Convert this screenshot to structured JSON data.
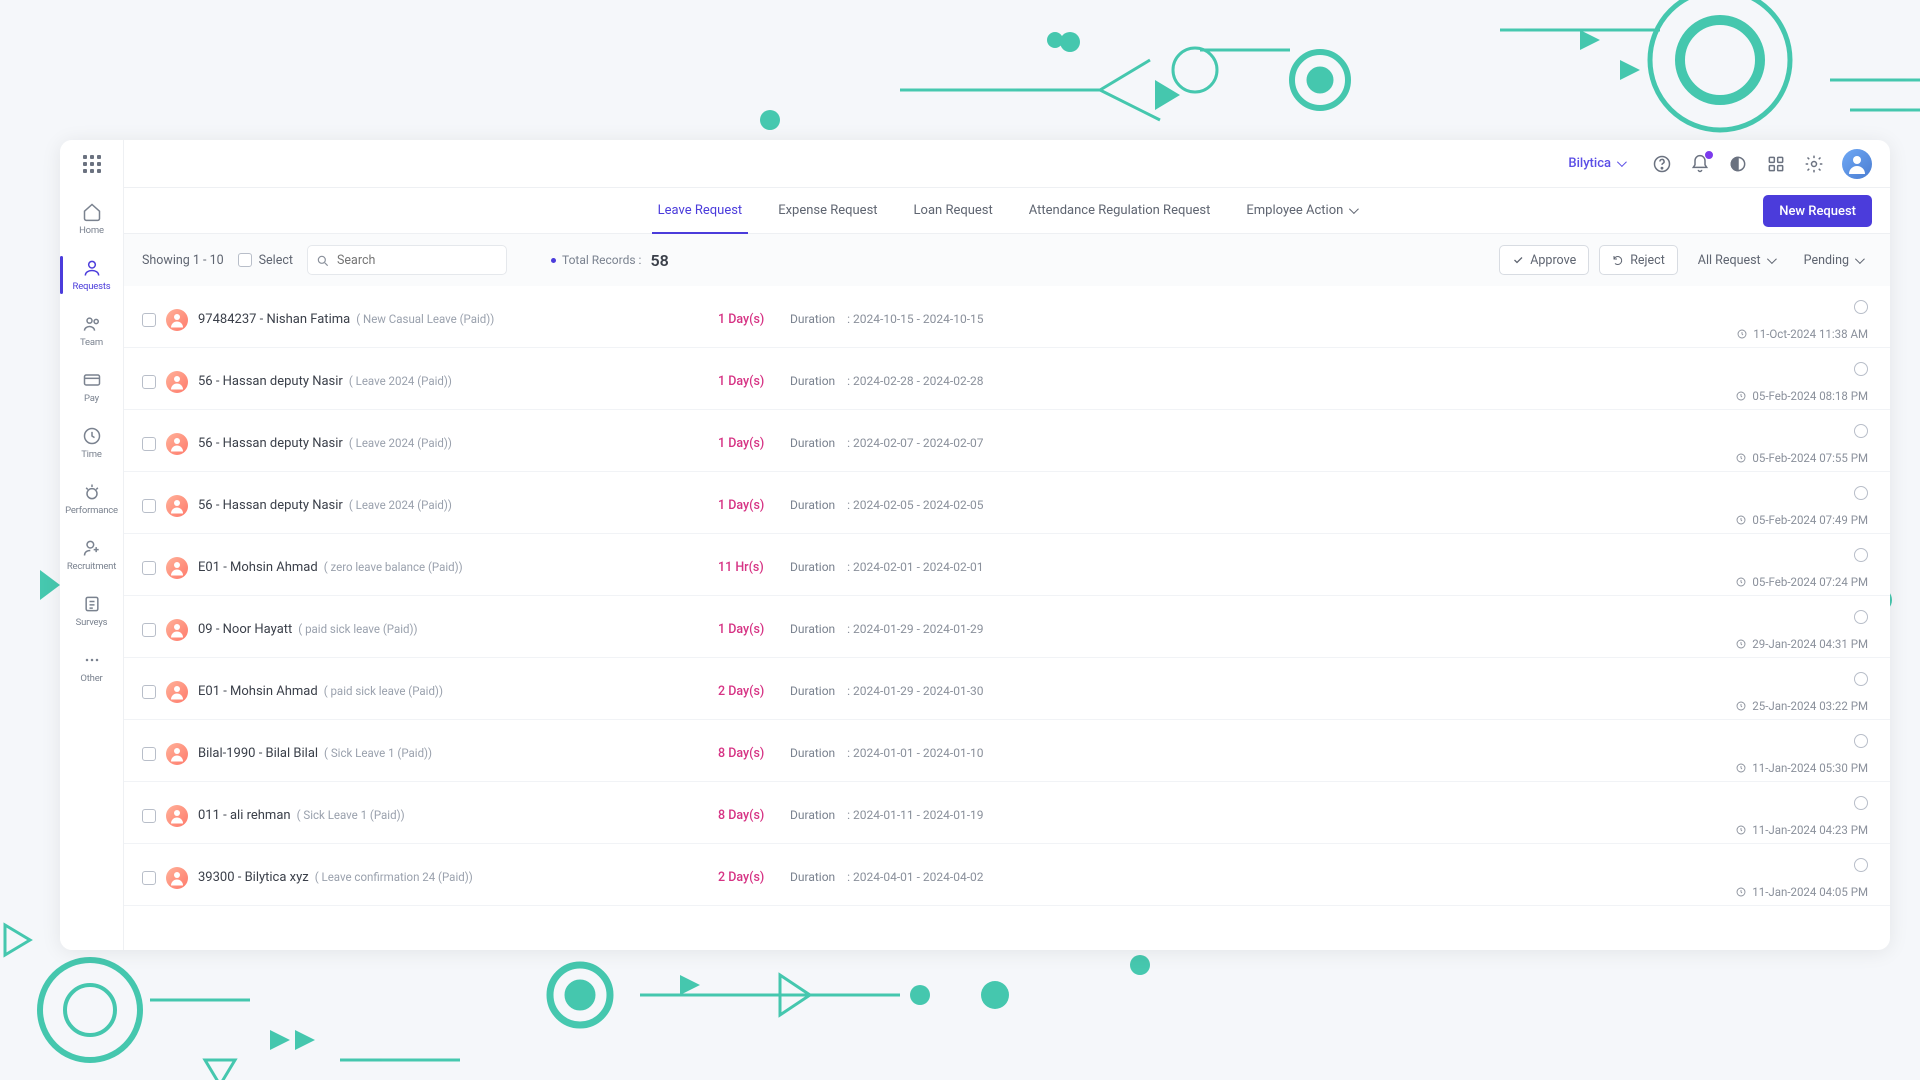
{
  "org": {
    "name": "Bilytica"
  },
  "sidebar": {
    "items": [
      {
        "label": "Home"
      },
      {
        "label": "Requests"
      },
      {
        "label": "Team"
      },
      {
        "label": "Pay"
      },
      {
        "label": "Time"
      },
      {
        "label": "Performance"
      },
      {
        "label": "Recruitment"
      },
      {
        "label": "Surveys"
      },
      {
        "label": "Other"
      }
    ]
  },
  "tabs": {
    "items": [
      {
        "label": "Leave Request"
      },
      {
        "label": "Expense Request"
      },
      {
        "label": "Loan Request"
      },
      {
        "label": "Attendance Regulation Request"
      },
      {
        "label": "Employee Action"
      }
    ],
    "new_button": "New Request"
  },
  "filters": {
    "showing": "Showing 1 - 10",
    "select_label": "Select",
    "search_placeholder": "Search",
    "total_label": "Total Records :",
    "total_value": "58",
    "approve": "Approve",
    "reject": "Reject",
    "all_request": "All Request",
    "pending": "Pending"
  },
  "duration_label": "Duration",
  "requests": [
    {
      "name": "97484237 - Nishan Fatima",
      "type": "( New Casual Leave (Paid))",
      "days": "1 Day(s)",
      "range": ": 2024-10-15 - 2024-10-15",
      "ts": "11-Oct-2024 11:38 AM"
    },
    {
      "name": "56 - Hassan deputy Nasir",
      "type": "( Leave 2024 (Paid))",
      "days": "1 Day(s)",
      "range": ": 2024-02-28 - 2024-02-28",
      "ts": "05-Feb-2024 08:18 PM"
    },
    {
      "name": "56 - Hassan deputy Nasir",
      "type": "( Leave 2024 (Paid))",
      "days": "1 Day(s)",
      "range": ": 2024-02-07 - 2024-02-07",
      "ts": "05-Feb-2024 07:55 PM"
    },
    {
      "name": "56 - Hassan deputy Nasir",
      "type": "( Leave 2024 (Paid))",
      "days": "1 Day(s)",
      "range": ": 2024-02-05 - 2024-02-05",
      "ts": "05-Feb-2024 07:49 PM"
    },
    {
      "name": "E01 - Mohsin Ahmad",
      "type": "( zero leave balance (Paid))",
      "days": "11 Hr(s)",
      "range": ": 2024-02-01 - 2024-02-01",
      "ts": "05-Feb-2024 07:24 PM"
    },
    {
      "name": "09 - Noor Hayatt",
      "type": "( paid sick leave (Paid))",
      "days": "1 Day(s)",
      "range": ": 2024-01-29 - 2024-01-29",
      "ts": "29-Jan-2024 04:31 PM"
    },
    {
      "name": "E01 - Mohsin Ahmad",
      "type": "( paid sick leave (Paid))",
      "days": "2 Day(s)",
      "range": ": 2024-01-29 - 2024-01-30",
      "ts": "25-Jan-2024 03:22 PM"
    },
    {
      "name": "Bilal-1990 - Bilal Bilal",
      "type": "( Sick Leave 1 (Paid))",
      "days": "8 Day(s)",
      "range": ": 2024-01-01 - 2024-01-10",
      "ts": "11-Jan-2024 05:30 PM"
    },
    {
      "name": "011 - ali rehman",
      "type": "( Sick Leave 1 (Paid))",
      "days": "8 Day(s)",
      "range": ": 2024-01-11 - 2024-01-19",
      "ts": "11-Jan-2024 04:23 PM"
    },
    {
      "name": "39300 - Bilytica xyz",
      "type": "( Leave confirmation 24 (Paid))",
      "days": "2 Day(s)",
      "range": ": 2024-04-01 - 2024-04-02",
      "ts": "11-Jan-2024 04:05 PM"
    }
  ]
}
